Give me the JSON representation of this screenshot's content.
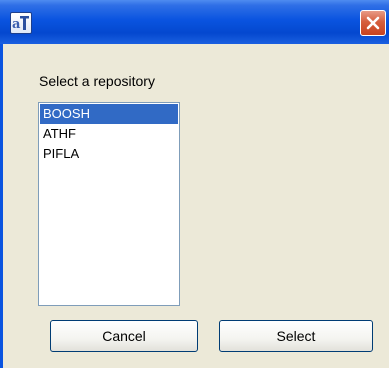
{
  "window": {
    "app_icon": "app-logo-icon",
    "close_icon": "close-icon"
  },
  "dialog": {
    "prompt": "Select a repository",
    "repositories": [
      "BOOSH",
      "ATHF",
      "PIFLA"
    ],
    "selected": "BOOSH",
    "cancel_label": "Cancel",
    "select_label": "Select"
  },
  "colors": {
    "titlebar": "#0a54e0",
    "close_button": "#d65f3e",
    "dialog_background": "#ece9d8",
    "selection": "#316ac5",
    "listbox_border": "#7f9db9",
    "button_border": "#003c74"
  }
}
